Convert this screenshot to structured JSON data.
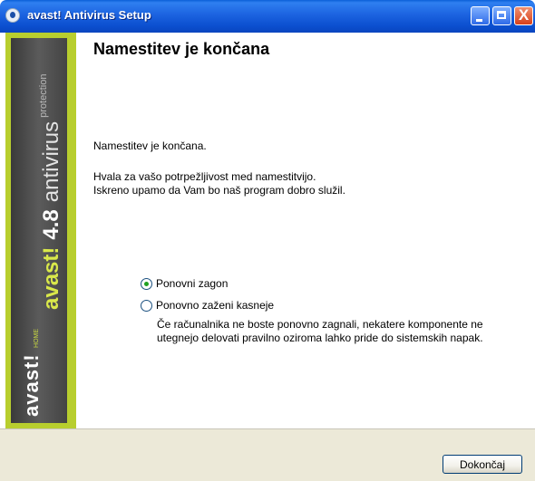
{
  "window": {
    "title": "avast! Antivirus Setup",
    "close_glyph": "X"
  },
  "banner": {
    "brand": "avast!",
    "version": "4.8",
    "product": "antivirus",
    "tagline": "protection",
    "logo": "avast!",
    "edition": "HOME"
  },
  "content": {
    "heading": "Namestitev je končana",
    "line1": "Namestitev je končana.",
    "line2": "Hvala za vašo potrpežljivost med namestitvijo.",
    "line3": "Iskreno upamo da Vam bo naš program dobro služil.",
    "options": [
      {
        "label": "Ponovni zagon",
        "checked": true
      },
      {
        "label": "Ponovno zaženi kasneje",
        "checked": false
      }
    ],
    "note_line1": "Če računalnika ne boste ponovno zagnali, nekatere komponente ne",
    "note_line2": "utegnejo delovati pravilno oziroma lahko pride do sistemskih napak."
  },
  "footer": {
    "finish_label": "Dokončaj"
  },
  "colors": {
    "titlebar": "#0b4fcf",
    "banner_accent": "#b8ce2e",
    "footer_bg": "#ece9d8"
  }
}
